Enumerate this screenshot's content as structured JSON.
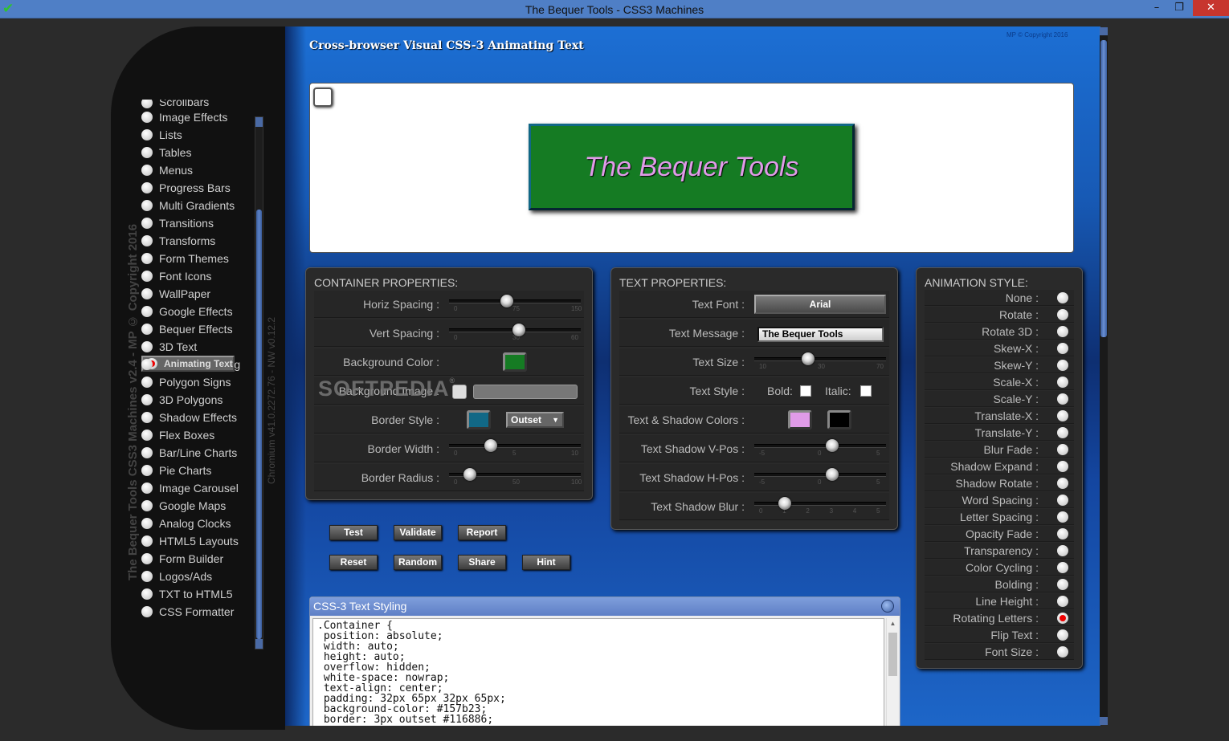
{
  "window": {
    "title": "The Bequer Tools - CSS3 Machines",
    "app_icon": "green-check-icon",
    "min_icon": "minimize-icon",
    "max_icon": "restore-icon",
    "close_icon": "close-icon",
    "min_glyph": "–",
    "max_glyph": "❐",
    "close_glyph": "✕"
  },
  "sidebar": {
    "vertical_title": "The Bequer Tools CSS3 Machines v2.4 - MP © Copyright 2016",
    "vertical_version": "Chromium v41.0.2272.76 - NW v0.12.2",
    "partial_item": "Scrollbars",
    "items": [
      {
        "label": "Image Effects"
      },
      {
        "label": "Lists"
      },
      {
        "label": "Tables"
      },
      {
        "label": "Menus"
      },
      {
        "label": "Progress Bars"
      },
      {
        "label": "Multi Gradients"
      },
      {
        "label": "Transitions"
      },
      {
        "label": "Transforms"
      },
      {
        "label": "Form Themes"
      },
      {
        "label": "Font Icons"
      },
      {
        "label": "WallPaper"
      },
      {
        "label": "Google Effects"
      },
      {
        "label": "Bequer Effects"
      },
      {
        "label": "3D Text"
      },
      {
        "label": "Animating Text",
        "selected": true
      },
      {
        "label": "Text Around Img"
      },
      {
        "label": "Polygon Signs"
      },
      {
        "label": "3D Polygons"
      },
      {
        "label": "Shadow Effects"
      },
      {
        "label": "Flex Boxes"
      },
      {
        "label": "Bar/Line Charts"
      },
      {
        "label": "Pie Charts"
      },
      {
        "label": "Image Carousel"
      },
      {
        "label": "Google Maps"
      },
      {
        "label": "Analog Clocks"
      },
      {
        "label": "HTML5 Layouts"
      },
      {
        "label": "Form Builder"
      },
      {
        "label": "Logos/Ads"
      },
      {
        "label": "TXT to HTML5"
      },
      {
        "label": "CSS Formatter"
      }
    ]
  },
  "main": {
    "header": "Cross-browser Visual CSS-3 Animating Text",
    "copyright": "MP © Copyright 2016",
    "preview": {
      "text": "The Bequer Tools",
      "background_color": "#157b23",
      "text_color": "#e09be8"
    },
    "container": {
      "title": "CONTAINER PROPERTIES:",
      "horiz_spacing": {
        "label": "Horiz Spacing :",
        "ticks": [
          "0",
          "75",
          "150"
        ],
        "min": 0,
        "max": 150,
        "value": 65
      },
      "vert_spacing": {
        "label": "Vert Spacing :",
        "ticks": [
          "0",
          "30",
          "60"
        ],
        "min": 0,
        "max": 60,
        "value": 32
      },
      "background_color": {
        "label": "Background Color :",
        "color": "#157b23"
      },
      "background_image": {
        "label": "Background Image :"
      },
      "border_style": {
        "label": "Border Style :",
        "color": "#116886",
        "value": "Outset"
      },
      "border_width": {
        "label": "Border Width :",
        "ticks": [
          "0",
          "5",
          "10"
        ],
        "min": 0,
        "max": 10,
        "value": 3
      },
      "border_radius": {
        "label": "Border Radius :",
        "ticks": [
          "0",
          "50",
          "100"
        ],
        "min": 0,
        "max": 100,
        "value": 12
      }
    },
    "text": {
      "title": "TEXT PROPERTIES:",
      "font": {
        "label": "Text Font :",
        "value": "Arial"
      },
      "message": {
        "label": "Text Message :",
        "value": "The Bequer Tools"
      },
      "size": {
        "label": "Text Size :",
        "ticks": [
          "10",
          "30",
          "70"
        ],
        "min": 10,
        "max": 70,
        "value": 34
      },
      "style": {
        "label": "Text Style :",
        "bold": "Bold:",
        "italic": "Italic:"
      },
      "colors": {
        "label": "Text & Shadow Colors :",
        "text_color": "#e09be8",
        "shadow_color": "#000000"
      },
      "vpos": {
        "label": "Text Shadow V-Pos :",
        "ticks": [
          "-5",
          "0",
          "5"
        ],
        "min": -5,
        "max": 5,
        "value": 1
      },
      "hpos": {
        "label": "Text Shadow H-Pos :",
        "ticks": [
          "-5",
          "0",
          "5"
        ],
        "min": -5,
        "max": 5,
        "value": 1
      },
      "blur": {
        "label": "Text Shadow Blur :",
        "ticks": [
          "0",
          "1",
          "2",
          "3",
          "4",
          "5"
        ],
        "min": 0,
        "max": 5,
        "value": 1
      }
    },
    "buttons": {
      "test": "Test",
      "validate": "Validate",
      "report": "Report",
      "reset": "Reset",
      "random": "Random",
      "share": "Share",
      "hint": "Hint"
    },
    "animation": {
      "title": "ANIMATION STYLE:",
      "items": [
        {
          "label": "None :"
        },
        {
          "label": "Rotate :"
        },
        {
          "label": "Rotate 3D :"
        },
        {
          "label": "Skew-X :"
        },
        {
          "label": "Skew-Y :"
        },
        {
          "label": "Scale-X :"
        },
        {
          "label": "Scale-Y :"
        },
        {
          "label": "Translate-X :"
        },
        {
          "label": "Translate-Y :"
        },
        {
          "label": "Blur Fade :"
        },
        {
          "label": "Shadow Expand :"
        },
        {
          "label": "Shadow Rotate :"
        },
        {
          "label": "Word Spacing :"
        },
        {
          "label": "Letter Spacing :"
        },
        {
          "label": "Opacity Fade :"
        },
        {
          "label": "Transparency :"
        },
        {
          "label": "Color Cycling :"
        },
        {
          "label": "Bolding :"
        },
        {
          "label": "Line Height :"
        },
        {
          "label": "Rotating Letters :",
          "selected": true
        },
        {
          "label": "Flip Text :"
        },
        {
          "label": "Font Size :"
        }
      ]
    },
    "css_panel": {
      "title": "CSS-3 Text Styling",
      "code": ".Container {\n position: absolute;\n width: auto;\n height: auto;\n overflow: hidden;\n white-space: nowrap;\n text-align: center;\n padding: 32px 65px 32px 65px;\n background-color: #157b23;\n border: 3px outset #116886;"
    },
    "watermark": "SOFTPEDIA",
    "watermark_mark": "®"
  }
}
